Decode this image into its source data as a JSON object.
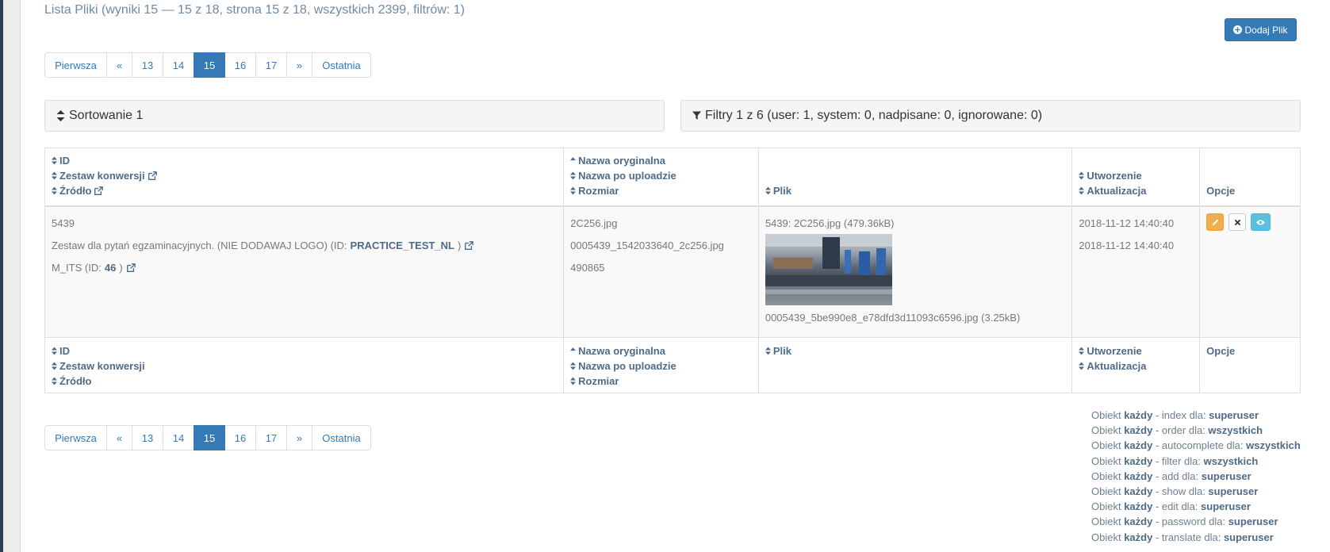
{
  "header": {
    "title": "Lista Pliki (wyniki 15 — 15 z 18, strona 15 z 18, wszystkich 2399, filtrów: 1)",
    "add_button": "Dodaj Plik"
  },
  "pagination": {
    "first": "Pierwsza",
    "prev": "«",
    "pages": [
      "13",
      "14",
      "15",
      "16",
      "17"
    ],
    "active": "15",
    "next": "»",
    "last": "Ostatnia"
  },
  "sorting": {
    "label": "Sortowanie 1"
  },
  "filters": {
    "label": "Filtry 1 z 6 (user: 1, system: 0, nadpisane: 0, ignorowane: 0)"
  },
  "table": {
    "headers": {
      "id": "ID",
      "zestaw": "Zestaw konwersji",
      "zrodlo": "Źródło",
      "nazwa_oryg": "Nazwa oryginalna",
      "nazwa_upload": "Nazwa po uploadzie",
      "rozmiar": "Rozmiar",
      "plik": "Plik",
      "utworzenie": "Utworzenie",
      "aktualizacja": "Aktualizacja",
      "opcje": "Opcje"
    },
    "row": {
      "id": "5439",
      "zestaw_text": "Zestaw dla pytań egzaminacyjnych. (NIE DODAWAJ LOGO) (ID: ",
      "zestaw_id": "PRACTICE_TEST_NL",
      "zestaw_close": ")",
      "zrodlo_text": "M_ITS (ID: ",
      "zrodlo_id": "46",
      "zrodlo_close": ")",
      "nazwa_oryg": "2C256.jpg",
      "nazwa_upload": "0005439_1542033640_2c256.jpg",
      "rozmiar": "490865",
      "plik_caption": "5439: 2C256.jpg (479.36kB)",
      "plik_thumb": "0005439_5be990e8_e78dfd3d11093c6596.jpg (3.25kB)",
      "utworzenie": "2018-11-12 14:40:40",
      "aktualizacja": "2018-11-12 14:40:40"
    }
  },
  "permissions": [
    {
      "prefix": "Obiekt ",
      "who": "każdy",
      "mid": " - index dla: ",
      "role": "superuser"
    },
    {
      "prefix": "Obiekt ",
      "who": "każdy",
      "mid": " - order dla: ",
      "role": "wszystkich"
    },
    {
      "prefix": "Obiekt ",
      "who": "każdy",
      "mid": " - autocomplete dla: ",
      "role": "wszystkich"
    },
    {
      "prefix": "Obiekt ",
      "who": "każdy",
      "mid": " - filter dla: ",
      "role": "wszystkich"
    },
    {
      "prefix": "Obiekt ",
      "who": "każdy",
      "mid": " - add dla: ",
      "role": "superuser"
    },
    {
      "prefix": "Obiekt ",
      "who": "każdy",
      "mid": " - show dla: ",
      "role": "superuser"
    },
    {
      "prefix": "Obiekt ",
      "who": "każdy",
      "mid": " - edit dla: ",
      "role": "superuser"
    },
    {
      "prefix": "Obiekt ",
      "who": "każdy",
      "mid": " - password dla: ",
      "role": "superuser"
    },
    {
      "prefix": "Obiekt ",
      "who": "każdy",
      "mid": " - translate dla: ",
      "role": "superuser"
    }
  ],
  "colors": {
    "primary": "#337ab7",
    "warning": "#f0ad4e",
    "info": "#5bc0de",
    "link_dark": "#4f6a86"
  }
}
